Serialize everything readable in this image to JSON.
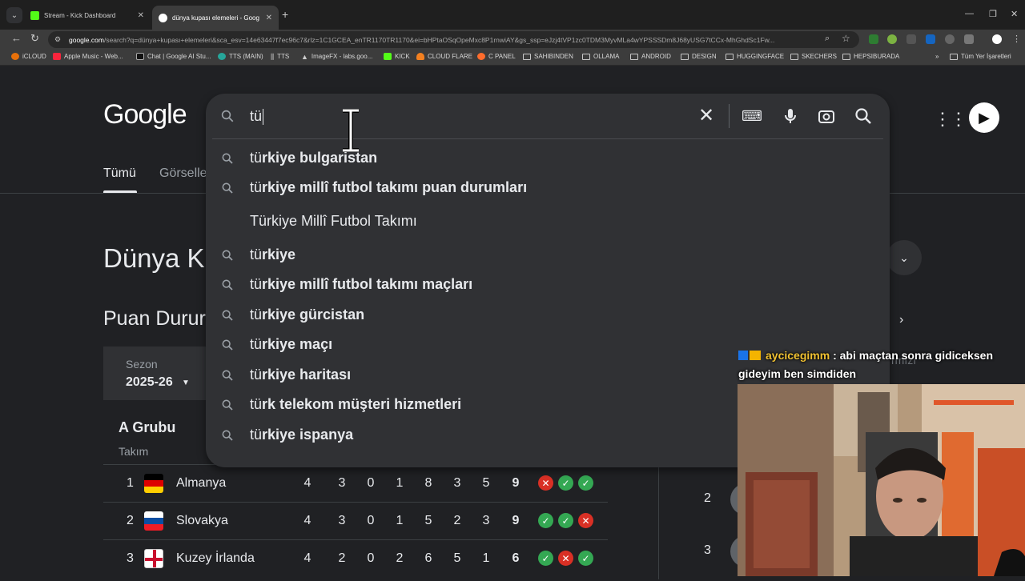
{
  "browser": {
    "tabs": [
      {
        "title": "Stream - Kick Dashboard",
        "fav_color": "#53fc18"
      },
      {
        "title": "dünya kupası elemeleri - Goog",
        "fav_color": "#ffffff"
      }
    ],
    "url_host": "google.com",
    "url_rest": "/search?q=dünya+kupası+elemeleri&sca_esv=14e63447f7ec96c7&rlz=1C1GCEA_enTR1170TR1170&ei=bHPtaOSqOpeMxc8P1rnwiAY&gs_ssp=eJzj4tVP1zc0TDM3MyvMLa4wYPSSSDm8J68yUSG7tCCx-MhGhdSc1Fw...",
    "bookmarks": [
      "iCLOUD",
      "Apple Music - Web...",
      "Chat | Google AI Stu...",
      "TTS (MAIN)",
      "TTS",
      "ImageFX - labs.goo...",
      "KICK",
      "CLOUD FLARE",
      "C PANEL",
      "SAHIBINDEN",
      "OLLAMA",
      "ANDROID",
      "DESIGN",
      "HUGGINGFACE",
      "SKECHERS",
      "HEPSIBURADA",
      "Tüm Yer İşaretleri"
    ]
  },
  "google": {
    "logo": "Google",
    "tab_all": "Tümü",
    "tab_images": "Görselle",
    "heading": "Dünya K",
    "subheading": "Puan Durur",
    "season_label": "Sezon",
    "season_value": "2025-26",
    "group_title": "A Grubu",
    "team_header": "Takım",
    "rows": [
      {
        "rank": "1",
        "team": "Almanya",
        "stats": [
          "4",
          "3",
          "0",
          "1",
          "8",
          "3",
          "5"
        ],
        "pts": "9",
        "form": [
          "l",
          "w",
          "w"
        ]
      },
      {
        "rank": "2",
        "team": "Slovakya",
        "stats": [
          "4",
          "3",
          "0",
          "1",
          "5",
          "2",
          "3"
        ],
        "pts": "9",
        "form": [
          "w",
          "w",
          "l"
        ]
      },
      {
        "rank": "3",
        "team": "Kuzey İrlanda",
        "stats": [
          "4",
          "2",
          "0",
          "2",
          "6",
          "5",
          "1"
        ],
        "pts": "6",
        "form": [
          "w",
          "l",
          "w"
        ]
      }
    ],
    "side_rank_2": "2",
    "side_rank_3": "3"
  },
  "search": {
    "query": "tü",
    "suggestions": [
      {
        "prefix": "tü",
        "rest": "rkiye bulgaristan",
        "entity": false
      },
      {
        "prefix": "tü",
        "rest": "rkiye millî futbol takımı puan durumları",
        "entity": false
      },
      {
        "prefix": "",
        "rest": "Türkiye Millî Futbol Takımı",
        "entity": true
      },
      {
        "prefix": "tü",
        "rest": "rkiye",
        "entity": false
      },
      {
        "prefix": "tü",
        "rest": "rkiye millî futbol takımı maçları",
        "entity": false
      },
      {
        "prefix": "tü",
        "rest": "rkiye gürcistan",
        "entity": false
      },
      {
        "prefix": "tü",
        "rest": "rkiye maçı",
        "entity": false
      },
      {
        "prefix": "tü",
        "rest": "rkiye haritası",
        "entity": false
      },
      {
        "prefix": "tü",
        "rest": "rk telekom müşteri hizmetleri",
        "entity": false
      },
      {
        "prefix": "tü",
        "rest": "rkiye ispanya",
        "entity": false
      }
    ]
  },
  "chat": {
    "username": "aycicegimm",
    "message": ": abi maçtan sonra gidiceksen gideyim ben simdiden",
    "ghost_text": "rmızı"
  },
  "colors": {
    "win": "#34a853",
    "loss": "#d93025",
    "bg": "#202124",
    "panel": "#303134"
  }
}
